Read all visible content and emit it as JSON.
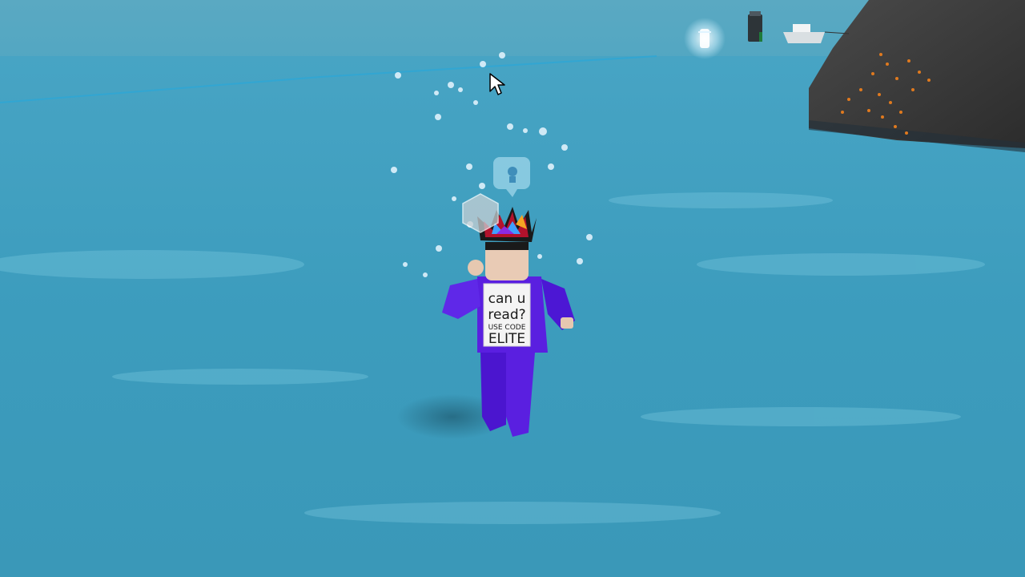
{
  "scene": {
    "environment": "open ocean",
    "colors": {
      "sky": "#5fb0c8",
      "water": "#3d9fbe",
      "water_highlight": "#6cc0da",
      "rock": "#3a3a3a",
      "avatar_body": "#5a1fe0",
      "bubble": "#e8f6ff"
    }
  },
  "avatar": {
    "shirt_lines": [
      "can u",
      "read?",
      "USE CODE",
      "ELITE"
    ],
    "icons": {
      "hat": "crown-icon",
      "badge": "hexagon-badge-icon",
      "emote": "speech-bubble-icon"
    }
  },
  "cursor": {
    "icon": "mouse-pointer-icon"
  },
  "distant_objects": {
    "icons": [
      "glowing-lantern-icon",
      "buoy-icon",
      "boat-icon",
      "rock-island-icon"
    ]
  }
}
